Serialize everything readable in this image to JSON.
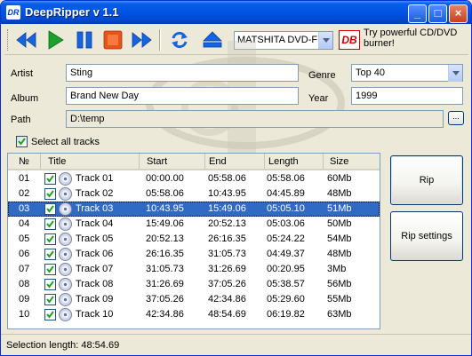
{
  "window": {
    "title": "DeepRipper v 1.1",
    "app_icon_text": "DR",
    "controls": {
      "minimize": "_",
      "maximize": "□",
      "close": "×"
    }
  },
  "toolbar": {
    "icons": [
      "rewind-icon",
      "play-icon",
      "pause-icon",
      "stop-icon",
      "fast-forward-icon",
      "refresh-icon",
      "eject-icon"
    ],
    "drive": "MATSHITA DVD-F",
    "promo_logo": "DB",
    "promo_text": "Try powerful CD/DVD burner!"
  },
  "form": {
    "artist_label": "Artist",
    "artist_value": "Sting",
    "album_label": "Album",
    "album_value": "Brand New Day",
    "path_label": "Path",
    "path_value": "D:\\temp",
    "browse_label": "...",
    "genre_label": "Genre",
    "genre_value": "Top 40",
    "year_label": "Year",
    "year_value": "1999",
    "select_all_label": "Select all tracks",
    "select_all_checked": true
  },
  "tracklist": {
    "headers": {
      "num": "№",
      "title": "Title",
      "start": "Start",
      "end": "End",
      "length": "Length",
      "size": "Size"
    },
    "rows": [
      {
        "num": "01",
        "title": "Track 01",
        "start": "00:00.00",
        "end": "05:58.06",
        "length": "05:58.06",
        "size": "60Mb"
      },
      {
        "num": "02",
        "title": "Track 02",
        "start": "05:58.06",
        "end": "10:43.95",
        "length": "04:45.89",
        "size": "48Mb"
      },
      {
        "num": "03",
        "title": "Track 03",
        "start": "10:43.95",
        "end": "15:49.06",
        "length": "05:05.10",
        "size": "51Mb"
      },
      {
        "num": "04",
        "title": "Track 04",
        "start": "15:49.06",
        "end": "20:52.13",
        "length": "05:03.06",
        "size": "50Mb"
      },
      {
        "num": "05",
        "title": "Track 05",
        "start": "20:52.13",
        "end": "26:16.35",
        "length": "05:24.22",
        "size": "54Mb"
      },
      {
        "num": "06",
        "title": "Track 06",
        "start": "26:16.35",
        "end": "31:05.73",
        "length": "04:49.37",
        "size": "48Mb"
      },
      {
        "num": "07",
        "title": "Track 07",
        "start": "31:05.73",
        "end": "31:26.69",
        "length": "00:20.95",
        "size": "3Mb"
      },
      {
        "num": "08",
        "title": "Track 08",
        "start": "31:26.69",
        "end": "37:05.26",
        "length": "05:38.57",
        "size": "56Mb"
      },
      {
        "num": "09",
        "title": "Track 09",
        "start": "37:05.26",
        "end": "42:34.86",
        "length": "05:29.60",
        "size": "55Mb"
      },
      {
        "num": "10",
        "title": "Track 10",
        "start": "42:34.86",
        "end": "48:54.69",
        "length": "06:19.82",
        "size": "63Mb"
      }
    ],
    "selected_index": 2
  },
  "buttons": {
    "rip": "Rip",
    "rip_settings": "Rip settings"
  },
  "status": {
    "text": "Selection length:  48:54.69"
  },
  "colors": {
    "accent": "#316ac5",
    "play": "#1aa12e",
    "stop": "#e8531b",
    "nav": "#1565e0"
  }
}
